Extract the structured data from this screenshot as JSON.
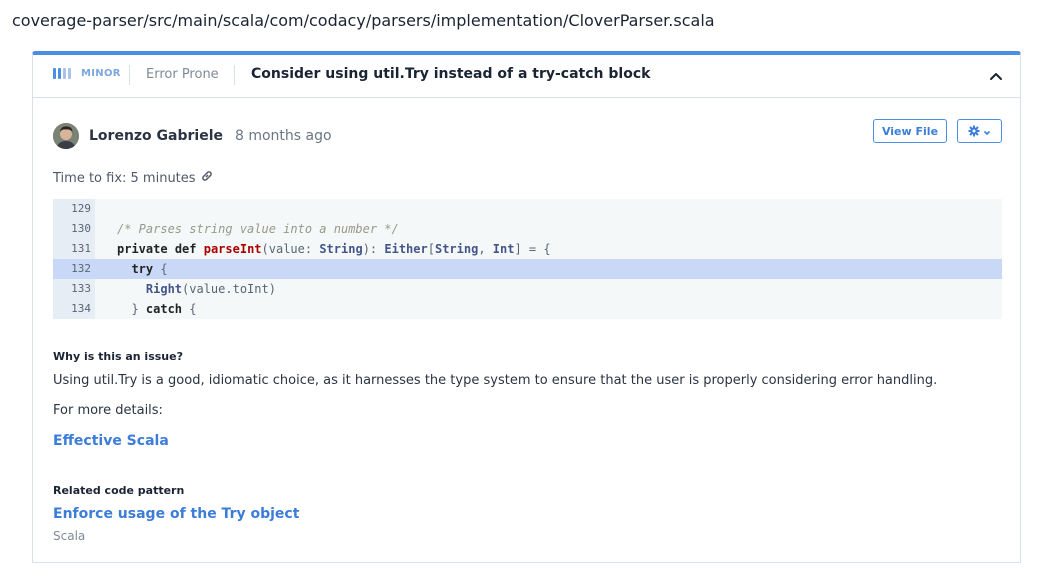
{
  "file_path": "coverage-parser/src/main/scala/com/codacy/parsers/implementation/CloverParser.scala",
  "issue": {
    "severity": "MINOR",
    "category": "Error Prone",
    "title": "Consider using util.Try instead of a try-catch block",
    "author": "Lorenzo Gabriele",
    "time_ago": "8 months ago",
    "time_to_fix": "Time to fix: 5 minutes",
    "view_file_label": "View File"
  },
  "code": {
    "lines": [
      {
        "num": "129"
      },
      {
        "num": "130"
      },
      {
        "num": "131"
      },
      {
        "num": "132"
      },
      {
        "num": "133"
      },
      {
        "num": "134"
      }
    ],
    "tokens": {
      "l130_comment": "/* Parses string value into a number */",
      "l131_private": "private",
      "l131_def": "def",
      "l131_name": "parseInt",
      "l131_p1": "(value: ",
      "l131_t1": "String",
      "l131_p2": "): ",
      "l131_t2": "Either",
      "l131_p3": "[",
      "l131_t3": "String",
      "l131_p4": ", ",
      "l131_t4": "Int",
      "l131_p5": "] = {",
      "l132_try": "try",
      "l132_brace": " {",
      "l133_right": "Right",
      "l133_args": "(value.toInt)",
      "l134_close": "} ",
      "l134_catch": "catch",
      "l134_brace": " {"
    }
  },
  "why": {
    "heading": "Why is this an issue?",
    "text": "Using util.Try is a good, idiomatic choice, as it harnesses the type system to ensure that the user is properly considering error handling.",
    "more": "For more details:",
    "link": "Effective Scala"
  },
  "related": {
    "heading": "Related code pattern",
    "link": "Enforce usage of the Try object",
    "language": "Scala"
  },
  "colors": {
    "accent": "#4a90e2",
    "highlight": "#c9d8f7"
  },
  "icons": {
    "severity": "severity-bars-icon",
    "collapse": "chevron-up-icon",
    "link": "link-icon",
    "gear": "gear-icon",
    "dropdown": "chevron-down-icon"
  }
}
